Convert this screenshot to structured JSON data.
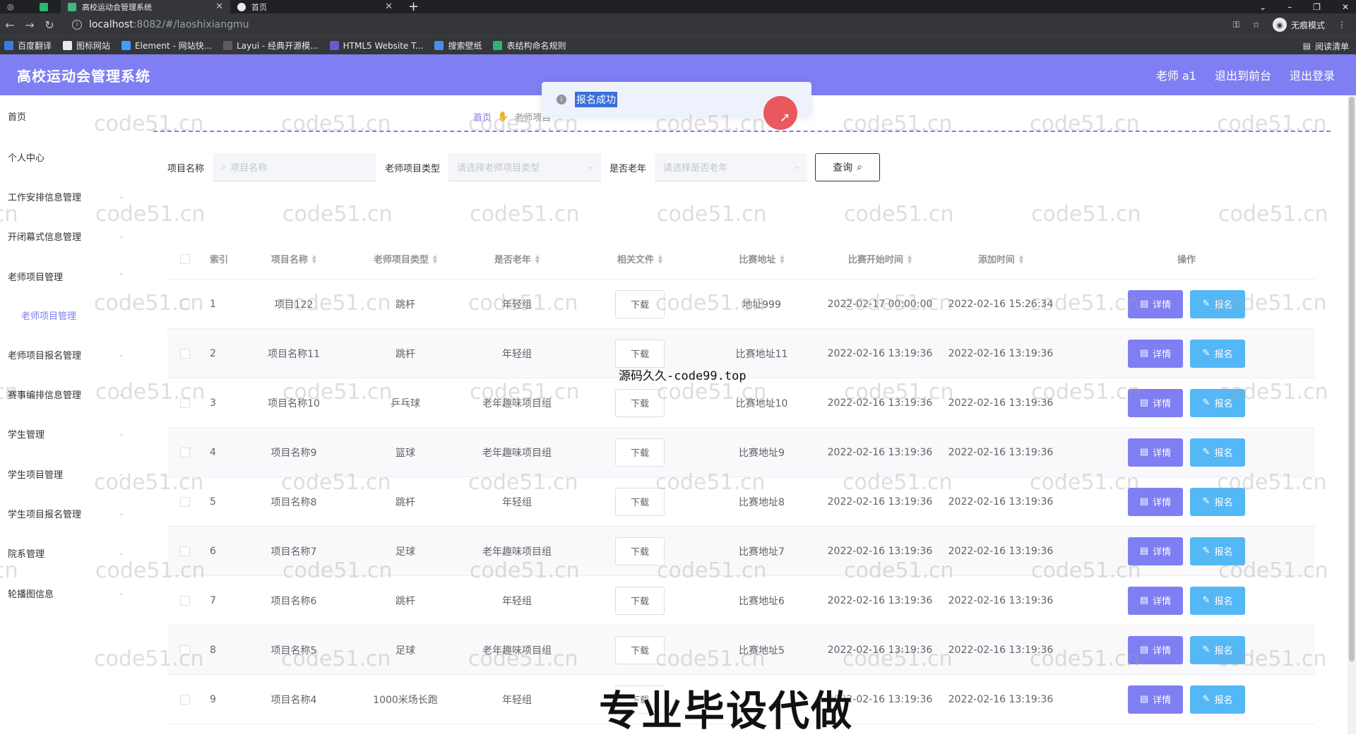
{
  "browser": {
    "tabs": [
      {
        "title": "高校运动会管理系统",
        "active": true
      },
      {
        "title": "首页",
        "active": false
      }
    ],
    "url_host": "localhost",
    "url_path": ":8082/#/laoshixiangmu",
    "incognito_label": "无痕模式",
    "bookmarks": [
      "百度翻译",
      "图标网站",
      "Element - 网站快...",
      "Layui - 经典开源模...",
      "HTML5 Website T...",
      "搜索壁纸",
      "表结构命名规则"
    ],
    "reading_list": "阅读清单"
  },
  "header": {
    "title": "高校运动会管理系统",
    "user": "老师 a1",
    "to_front": "退出到前台",
    "logout": "退出登录",
    "accent_color": "#7f7ef2"
  },
  "sidebar": {
    "items": [
      {
        "label": "首页",
        "has_children": false
      },
      {
        "label": "个人中心",
        "has_children": false
      },
      {
        "label": "工作安排信息管理",
        "has_children": true
      },
      {
        "label": "开闭幕式信息管理",
        "has_children": true
      },
      {
        "label": "老师项目管理",
        "has_children": true
      },
      {
        "label": "老师项目管理",
        "sub": true
      },
      {
        "label": "老师项目报名管理",
        "has_children": true
      },
      {
        "label": "赛事编排信息管理",
        "has_children": true
      },
      {
        "label": "学生管理",
        "has_children": true
      },
      {
        "label": "学生项目管理",
        "has_children": true
      },
      {
        "label": "学生项目报名管理",
        "has_children": true
      },
      {
        "label": "院系管理",
        "has_children": true
      },
      {
        "label": "轮播图信息",
        "has_children": true
      }
    ]
  },
  "breadcrumb": {
    "home": "首页",
    "current": "老师项目"
  },
  "toast": {
    "message": "报名成功"
  },
  "search": {
    "name_label": "项目名称",
    "name_placeholder": "项目名称",
    "type_label": "老师项目类型",
    "type_placeholder": "请选择老师项目类型",
    "old_label": "是否老年",
    "old_placeholder": "请选择是否老年",
    "query_label": "查询"
  },
  "table": {
    "headers": [
      "索引",
      "项目名称",
      "老师项目类型",
      "是否老年",
      "相关文件",
      "比赛地址",
      "比赛开始时间",
      "添加时间",
      "操作"
    ],
    "download_label": "下载",
    "detail_label": "详情",
    "apply_label": "报名",
    "rows": [
      {
        "idx": "1",
        "name": "项目122",
        "type": "跳杆",
        "old": "年轻组",
        "addr": "地址999",
        "start": "2022-02-17 00:00:00",
        "added": "2022-02-16 15:26:34"
      },
      {
        "idx": "2",
        "name": "项目名称11",
        "type": "跳杆",
        "old": "年轻组",
        "addr": "比赛地址11",
        "start": "2022-02-16 13:19:36",
        "added": "2022-02-16 13:19:36"
      },
      {
        "idx": "3",
        "name": "项目名称10",
        "type": "乒乓球",
        "old": "老年趣味项目组",
        "addr": "比赛地址10",
        "start": "2022-02-16 13:19:36",
        "added": "2022-02-16 13:19:36"
      },
      {
        "idx": "4",
        "name": "项目名称9",
        "type": "篮球",
        "old": "老年趣味项目组",
        "addr": "比赛地址9",
        "start": "2022-02-16 13:19:36",
        "added": "2022-02-16 13:19:36"
      },
      {
        "idx": "5",
        "name": "项目名称8",
        "type": "跳杆",
        "old": "年轻组",
        "addr": "比赛地址8",
        "start": "2022-02-16 13:19:36",
        "added": "2022-02-16 13:19:36"
      },
      {
        "idx": "6",
        "name": "项目名称7",
        "type": "足球",
        "old": "老年趣味项目组",
        "addr": "比赛地址7",
        "start": "2022-02-16 13:19:36",
        "added": "2022-02-16 13:19:36"
      },
      {
        "idx": "7",
        "name": "项目名称6",
        "type": "跳杆",
        "old": "年轻组",
        "addr": "比赛地址6",
        "start": "2022-02-16 13:19:36",
        "added": "2022-02-16 13:19:36"
      },
      {
        "idx": "8",
        "name": "项目名称5",
        "type": "足球",
        "old": "老年趣味项目组",
        "addr": "比赛地址5",
        "start": "2022-02-16 13:19:36",
        "added": "2022-02-16 13:19:36"
      },
      {
        "idx": "9",
        "name": "项目名称4",
        "type": "1000米场长跑",
        "old": "年轻组",
        "addr": "",
        "start": "2022-02-16 13:19:36",
        "added": "2022-02-16 13:19:36"
      }
    ]
  },
  "overlays": {
    "watermark": "code51.cn",
    "mid_text": "源码久久-code99.top",
    "big_text": "专业毕设代做"
  }
}
